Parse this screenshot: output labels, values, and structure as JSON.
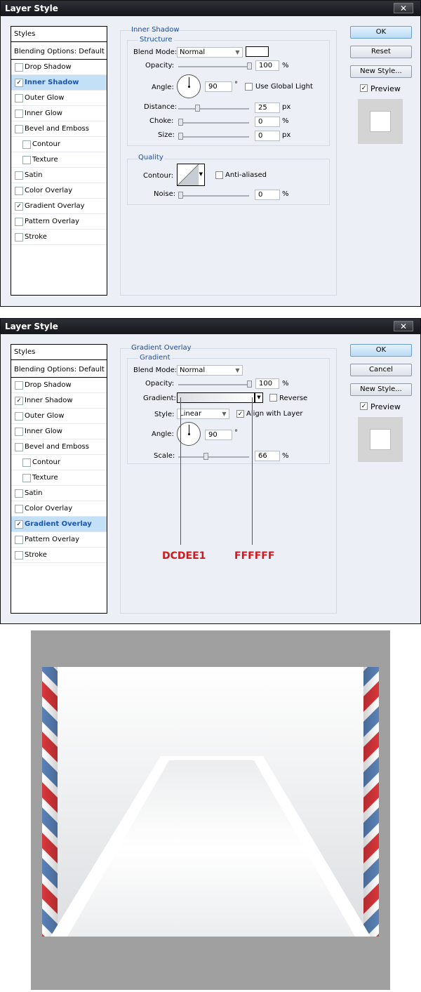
{
  "dialog1": {
    "title": "Layer Style",
    "close_label": "✕",
    "styles_header": "Styles",
    "blending_options": "Blending Options: Default",
    "styles": [
      {
        "label": "Drop Shadow",
        "checked": false,
        "indent": false
      },
      {
        "label": "Inner Shadow",
        "checked": true,
        "indent": false
      },
      {
        "label": "Outer Glow",
        "checked": false,
        "indent": false
      },
      {
        "label": "Inner Glow",
        "checked": false,
        "indent": false
      },
      {
        "label": "Bevel and Emboss",
        "checked": false,
        "indent": false
      },
      {
        "label": "Contour",
        "checked": false,
        "indent": true
      },
      {
        "label": "Texture",
        "checked": false,
        "indent": true
      },
      {
        "label": "Satin",
        "checked": false,
        "indent": false
      },
      {
        "label": "Color Overlay",
        "checked": false,
        "indent": false
      },
      {
        "label": "Gradient Overlay",
        "checked": true,
        "indent": false
      },
      {
        "label": "Pattern Overlay",
        "checked": false,
        "indent": false
      },
      {
        "label": "Stroke",
        "checked": false,
        "indent": false
      }
    ],
    "selected_style": "Inner Shadow",
    "section_title": "Inner Shadow",
    "structure_title": "Structure",
    "blend_mode_label": "Blend Mode:",
    "blend_mode_value": "Normal",
    "blend_color": "#ffffff",
    "opacity_label": "Opacity:",
    "opacity_value": "100",
    "opacity_level": 1.0,
    "opacity_unit": "%",
    "angle_label": "Angle:",
    "angle_value": "90",
    "angle_unit": "°",
    "use_global_light_label": "Use Global Light",
    "use_global_light_checked": false,
    "distance_label": "Distance:",
    "distance_value": "25",
    "distance_level": 0.25,
    "distance_unit": "px",
    "choke_label": "Choke:",
    "choke_value": "0",
    "choke_level": 0,
    "choke_unit": "%",
    "size_label": "Size:",
    "size_value": "0",
    "size_level": 0,
    "size_unit": "px",
    "quality_title": "Quality",
    "contour_label": "Contour:",
    "anti_aliased_label": "Anti-aliased",
    "anti_aliased_checked": false,
    "noise_label": "Noise:",
    "noise_value": "0",
    "noise_level": 0,
    "noise_unit": "%",
    "ok_label": "OK",
    "reset_label": "Reset",
    "new_style_label": "New Style...",
    "preview_label": "Preview",
    "preview_checked": true
  },
  "dialog2": {
    "title": "Layer Style",
    "close_label": "✕",
    "styles_header": "Styles",
    "blending_options": "Blending Options: Default",
    "styles": [
      {
        "label": "Drop Shadow",
        "checked": false,
        "indent": false
      },
      {
        "label": "Inner Shadow",
        "checked": true,
        "indent": false
      },
      {
        "label": "Outer Glow",
        "checked": false,
        "indent": false
      },
      {
        "label": "Inner Glow",
        "checked": false,
        "indent": false
      },
      {
        "label": "Bevel and Emboss",
        "checked": false,
        "indent": false
      },
      {
        "label": "Contour",
        "checked": false,
        "indent": true
      },
      {
        "label": "Texture",
        "checked": false,
        "indent": true
      },
      {
        "label": "Satin",
        "checked": false,
        "indent": false
      },
      {
        "label": "Color Overlay",
        "checked": false,
        "indent": false
      },
      {
        "label": "Gradient Overlay",
        "checked": true,
        "indent": false
      },
      {
        "label": "Pattern Overlay",
        "checked": false,
        "indent": false
      },
      {
        "label": "Stroke",
        "checked": false,
        "indent": false
      }
    ],
    "selected_style": "Gradient Overlay",
    "section_title": "Gradient Overlay",
    "gradient_title": "Gradient",
    "blend_mode_label": "Blend Mode:",
    "blend_mode_value": "Normal",
    "opacity_label": "Opacity:",
    "opacity_value": "100",
    "opacity_level": 1.0,
    "opacity_unit": "%",
    "gradient_label": "Gradient:",
    "gradient_colors": [
      "#dcdee1",
      "#ffffff"
    ],
    "reverse_label": "Reverse",
    "reverse_checked": false,
    "style_label": "Style:",
    "style_value": "Linear",
    "align_with_layer_label": "Align with Layer",
    "align_with_layer_checked": true,
    "angle_label": "Angle:",
    "angle_value": "90",
    "angle_unit": "°",
    "scale_label": "Scale:",
    "scale_value": "66",
    "scale_level": 0.38,
    "scale_unit": "%",
    "annotation_left": "DCDEE1",
    "annotation_right": "FFFFFF",
    "ok_label": "OK",
    "cancel_label": "Cancel",
    "new_style_label": "New Style...",
    "preview_label": "Preview",
    "preview_checked": true
  },
  "envelope": {
    "background_color": "#a0a0a0",
    "stripe_colors": [
      "#d9363b",
      "#ffffff",
      "#5a82b8"
    ]
  }
}
